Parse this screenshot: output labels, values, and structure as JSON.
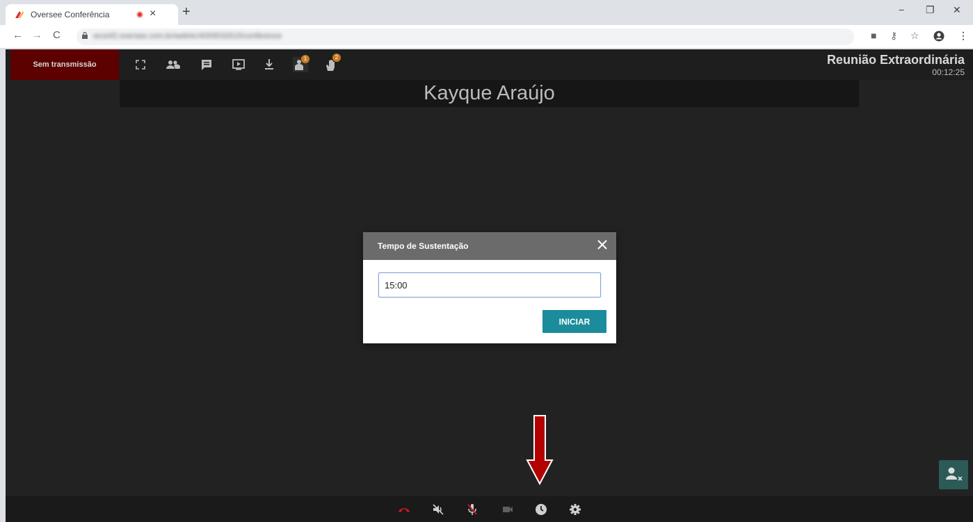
{
  "browser": {
    "tab_title": "Oversee Conferência",
    "tab_close": "×",
    "new_tab": "+",
    "window_minimize": "−",
    "window_restore": "❐",
    "window_close": "✕",
    "url": "wconf2.oversee.com.br/webrtc/4059532615/conference",
    "nav_back": "←",
    "nav_forward": "→",
    "nav_reload": "C"
  },
  "app": {
    "broadcast_button": "Sem transmissão",
    "meeting_title": "Reunião Extraordinária",
    "meeting_time": "00:12:25",
    "speaker_name": "Kayque Araújo",
    "toolbar_icons": [
      "fullscreen-icon",
      "participants-icon",
      "chat-icon",
      "presentation-icon",
      "download-icon",
      "speaker-request-icon",
      "raise-hand-icon"
    ],
    "badges": {
      "speaker_request": "1",
      "raise_hand": "2"
    },
    "bottom_icons": [
      "hangup-icon",
      "speaker-mute-icon",
      "mic-mute-icon",
      "camera-icon",
      "clock-icon",
      "settings-icon"
    ]
  },
  "modal": {
    "title": "Tempo de Sustentação",
    "input_value": "15:00",
    "start_button": "INICIAR"
  },
  "colors": {
    "accent_teal": "#1b8c9c",
    "broadcast_red": "#5c0000",
    "arrow_red": "#b30000"
  }
}
